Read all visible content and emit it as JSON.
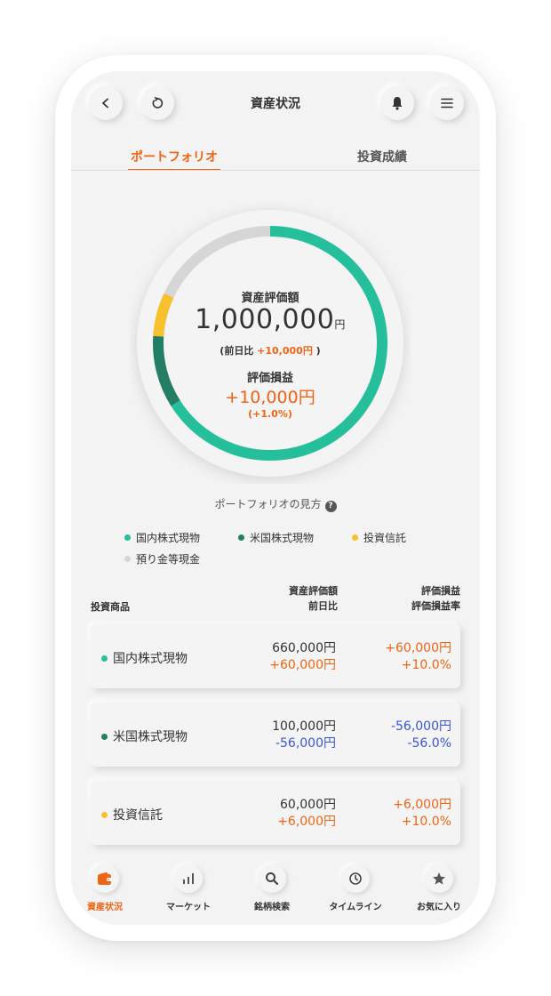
{
  "header": {
    "title": "資産状況",
    "back_icon": "chevron-left-icon",
    "refresh_icon": "refresh-icon",
    "bell_icon": "bell-icon",
    "menu_icon": "hamburger-menu-icon"
  },
  "tabs": [
    {
      "label": "ポートフォリオ",
      "active": true
    },
    {
      "label": "投資成績",
      "active": false
    }
  ],
  "summary": {
    "asset_label": "資産評価額",
    "asset_amount": "1,000,000",
    "asset_unit": "円",
    "change_prefix": "(前日比 ",
    "change_value": "+10,000円",
    "change_suffix": " )",
    "pl_label": "評価損益",
    "pl_value": "+10,000円",
    "pl_rate": "(+1.0%)"
  },
  "chart_data": {
    "type": "pie",
    "style": "donut",
    "slices": [
      {
        "label": "国内株式現物",
        "value": 660000,
        "color": "#25bf9c"
      },
      {
        "label": "米国株式現物",
        "value": 100000,
        "color": "#237e63"
      },
      {
        "label": "投資信託",
        "value": 60000,
        "color": "#f6c12a"
      },
      {
        "label": "預り金等現金",
        "value": 180000,
        "color": "#d6d6d6"
      }
    ]
  },
  "portfolio_howto": {
    "label": "ポートフォリオの見方",
    "icon": "help-icon"
  },
  "legend": [
    {
      "label": "国内株式現物",
      "color": "#25bf9c"
    },
    {
      "label": "米国株式現物",
      "color": "#237e63"
    },
    {
      "label": "投資信託",
      "color": "#f6c12a"
    },
    {
      "label": "預り金等現金",
      "color": "#d6d6d6"
    }
  ],
  "table_header": {
    "product": "投資商品",
    "valuation": "資産評価額",
    "prev_day": "前日比",
    "pl": "評価損益",
    "pl_rate": "評価損益率"
  },
  "holdings": [
    {
      "name": "国内株式現物",
      "color": "#25bf9c",
      "value": "660,000円",
      "change": "+60,000円",
      "pl": "+60,000円",
      "pl_rate": "+10.0%",
      "sign": "positive"
    },
    {
      "name": "米国株式現物",
      "color": "#237e63",
      "value": "100,000円",
      "change": "-56,000円",
      "pl": "-56,000円",
      "pl_rate": "-56.0%",
      "sign": "negative"
    },
    {
      "name": "投資信託",
      "color": "#f6c12a",
      "value": "60,000円",
      "change": "+6,000円",
      "pl": "+6,000円",
      "pl_rate": "+10.0%",
      "sign": "positive"
    }
  ],
  "bottom_nav": [
    {
      "label": "資産状況",
      "icon": "wallet-icon",
      "active": true
    },
    {
      "label": "マーケット",
      "icon": "bar-chart-icon",
      "active": false
    },
    {
      "label": "銘柄検索",
      "icon": "search-icon",
      "active": false
    },
    {
      "label": "タイムライン",
      "icon": "clock-icon",
      "active": false
    },
    {
      "label": "お気に入り",
      "icon": "star-icon",
      "active": false
    }
  ],
  "colors": {
    "accent": "#ef6414",
    "positive": "#ef6414",
    "negative": "#3a55d4",
    "background": "#f3f3f3"
  }
}
